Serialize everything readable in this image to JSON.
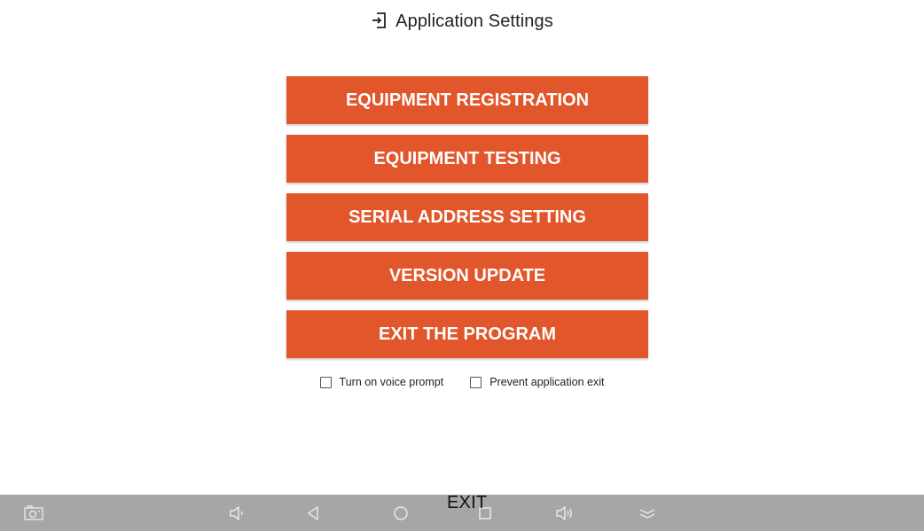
{
  "header": {
    "title": "Application Settings",
    "icon": "login-icon"
  },
  "menu": {
    "buttons": [
      {
        "label": "EQUIPMENT REGISTRATION"
      },
      {
        "label": "EQUIPMENT TESTING"
      },
      {
        "label": "SERIAL ADDRESS SETTING"
      },
      {
        "label": "VERSION UPDATE"
      },
      {
        "label": "EXIT THE PROGRAM"
      }
    ],
    "accent_color": "#e1562a"
  },
  "options": [
    {
      "label": "Turn on voice prompt",
      "checked": false
    },
    {
      "label": "Prevent application exit",
      "checked": false
    }
  ],
  "overlay": {
    "exit_label": "EXIT"
  },
  "navbar": {
    "background": "#a6a6a6",
    "icons": [
      "screenshot-icon",
      "volume-down-icon",
      "back-icon",
      "home-icon",
      "recents-icon",
      "volume-up-icon",
      "hide-bar-icon"
    ]
  }
}
